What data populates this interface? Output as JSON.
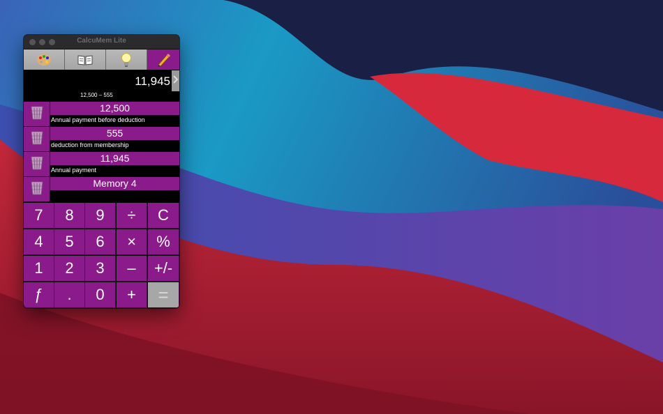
{
  "window": {
    "title": "CalcuMem Lite"
  },
  "toolbar": {
    "buttons": [
      {
        "icon": "palette-icon"
      },
      {
        "icon": "book-icon"
      },
      {
        "icon": "lightbulb-icon"
      },
      {
        "icon": "pencil-icon",
        "active": true
      }
    ]
  },
  "display": {
    "value": "11,945",
    "expression": "12,500  –  555"
  },
  "memories": [
    {
      "value": "12,500",
      "label": "Annual payment before deduction"
    },
    {
      "value": "555",
      "label": "deduction from membership"
    },
    {
      "value": "11,945",
      "label": "Annual payment"
    },
    {
      "value": "Memory 4",
      "label": ""
    }
  ],
  "keypad": {
    "rows": [
      [
        "7",
        "8",
        "9",
        "÷",
        "C"
      ],
      [
        "4",
        "5",
        "6",
        "×",
        "%"
      ],
      [
        "1",
        "2",
        "3",
        "–",
        "+/-"
      ],
      [
        "ƒ",
        ".",
        "0",
        "+",
        "="
      ]
    ]
  },
  "colors": {
    "accent": "#8b1a8a",
    "equals_key": "#a7a7a7"
  }
}
